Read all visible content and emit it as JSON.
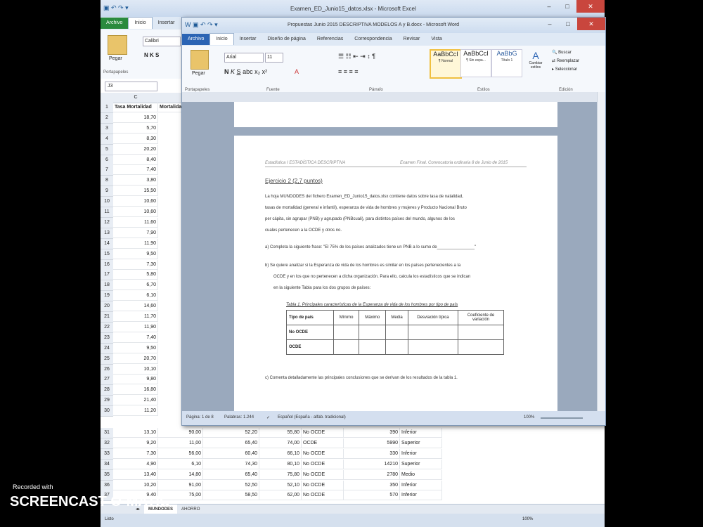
{
  "excel": {
    "title": "Examen_ED_Junio15_datos.xlsx - Microsoft Excel",
    "tabs": [
      "Archivo",
      "Inicio",
      "Insertar"
    ],
    "font_name": "Calibri",
    "clipboard_label": "Pegar",
    "group_label": "Portapapeles",
    "name_box": "J3",
    "col_headers": [
      "C"
    ],
    "header_row": [
      "Tasa Mortalidad",
      "Mortalidad"
    ],
    "col_c_values": [
      "18,70",
      "5,70",
      "8,30",
      "20,20",
      "8,40",
      "7,40",
      "3,80",
      "15,50",
      "10,60",
      "10,60",
      "11,60",
      "7,90",
      "11,90",
      "9,50",
      "7,30",
      "5,80",
      "6,70",
      "6,10",
      "14,60",
      "11,70",
      "11,90",
      "7,40",
      "9,50",
      "20,70",
      "10,10",
      "9,80",
      "16,80",
      "21,40",
      "11,20"
    ],
    "bottom_rows": [
      {
        "row": "31",
        "c": "13,10",
        "d": "90,00",
        "e": "52,20",
        "f": "55,80",
        "g": "No OCDE",
        "h": "390",
        "i": "Inferior"
      },
      {
        "row": "32",
        "c": "9,20",
        "d": "11,00",
        "e": "65,40",
        "f": "74,00",
        "g": "OCDE",
        "h": "5990",
        "i": "Superior"
      },
      {
        "row": "33",
        "c": "7,30",
        "d": "56,00",
        "e": "60,40",
        "f": "66,10",
        "g": "No OCDE",
        "h": "330",
        "i": "Inferior"
      },
      {
        "row": "34",
        "c": "4,90",
        "d": "6,10",
        "e": "74,30",
        "f": "80,10",
        "g": "No OCDE",
        "h": "14210",
        "i": "Superior"
      },
      {
        "row": "35",
        "c": "13,40",
        "d": "14,80",
        "e": "65,40",
        "f": "75,80",
        "g": "No OCDE",
        "h": "2780",
        "i": "Medio"
      },
      {
        "row": "36",
        "c": "10,20",
        "d": "91,00",
        "e": "52,50",
        "f": "52,10",
        "g": "No OCDE",
        "h": "350",
        "i": "Inferior"
      },
      {
        "row": "37",
        "c": "9,40",
        "d": "75,00",
        "e": "58,50",
        "f": "62,00",
        "g": "No OCDE",
        "h": "570",
        "i": "Inferior"
      }
    ],
    "sheet_tabs": [
      "MUNDODES",
      "AHORRO"
    ],
    "status_left": "Listo",
    "zoom": "100%"
  },
  "word": {
    "title": "Propuestas Junio 2015 DESCRIPTIVA MODELOS A y B.docx - Microsoft Word",
    "tabs": [
      "Archivo",
      "Inicio",
      "Insertar",
      "Diseño de página",
      "Referencias",
      "Correspondencia",
      "Revisar",
      "Vista"
    ],
    "font_name": "Arial",
    "font_size": "11",
    "clipboard_label": "Pegar",
    "groups": [
      "Portapapeles",
      "Fuente",
      "Párrafo",
      "Estilos",
      "Edición"
    ],
    "styles": [
      {
        "preview": "AaBbCcI",
        "name": "¶ Normal"
      },
      {
        "preview": "AaBbCcI",
        "name": "¶ Sin espa..."
      },
      {
        "preview": "AaBbG",
        "name": "Título 1"
      }
    ],
    "change_styles": "Cambiar estilos",
    "editing": [
      "Buscar",
      "Reemplazar",
      "Seleccionar"
    ],
    "doc": {
      "header_left": "Estadística I ESTADÍSTICA DESCRIPTIVA",
      "header_right": "Examen Final. Convocatoria ordinaria 8 de Junio de 2015",
      "exercise_title": "Ejercicio 2 (2,7 puntos)",
      "intro_1": "La hoja MUNDODES del fichero Examen_ED_Junio15_datos.xlsx contiene datos sobre tasa de natalidad,",
      "intro_2": "tasas de mortalidad (general e infantil), esperanza de vida de hombres y mujeres y Producto Nacional Bruto",
      "intro_3": "per cápita, sin agrupar (PNB) y agrupado (PNBcuali), para distintos países del mundo, algunos de los",
      "intro_4": "cuales pertenecen a la OCDE y otros no.",
      "item_a": "a)  Completa la siguiente frase: \"El 75% de los países analizados tiene un PNB a lo sumo de________________\"",
      "item_b1": "b)  Se quiere analizar si la Esperanza de vida de los hombres es similar en los países pertenecientes a la",
      "item_b2": "OCDE y en los que no pertenecen a dicha organización. Para ello, calcula los estadísticos que se indican",
      "item_b3": "en la siguiente Tabla para los dos grupos de países:",
      "table_caption": "Tabla 1. Principales características de la Esperanza de vida de los hombres por tipo de país",
      "table_headers": [
        "Tipo de país",
        "Mínimo",
        "Máximo",
        "Media",
        "Desviación típica",
        "Coeficiente de variación"
      ],
      "table_rows": [
        "No OCDE",
        "OCDE"
      ],
      "item_c": "c)  Comenta detalladamente las principales conclusiones que se derivan de los resultados de la tabla 1."
    },
    "status": {
      "page": "Página: 1 de 8",
      "words": "Palabras: 1.244",
      "language": "Español (España - alfab. tradicional)",
      "zoom": "100%"
    }
  },
  "watermark": {
    "line1": "Recorded with",
    "line2": "SCREENCAST-O-MATIC"
  }
}
